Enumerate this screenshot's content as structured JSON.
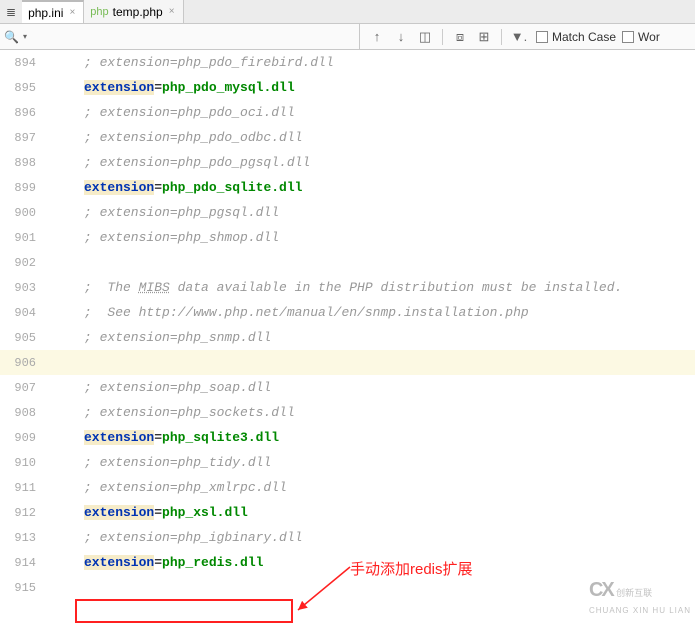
{
  "tabs": [
    {
      "label": "php.ini",
      "icon": "≣"
    },
    {
      "label": "temp.php",
      "icon": "php"
    }
  ],
  "toolbar": {
    "matchCase": "Match Case",
    "words": "Wor"
  },
  "lines": [
    {
      "num": "894",
      "type": "comment",
      "text": "; extension=php_pdo_firebird.dll"
    },
    {
      "num": "895",
      "type": "active",
      "key": "extension",
      "eq": "=",
      "val": "php_pdo_mysql.dll"
    },
    {
      "num": "896",
      "type": "comment",
      "text": "; extension=php_pdo_oci.dll"
    },
    {
      "num": "897",
      "type": "comment",
      "text": "; extension=php_pdo_odbc.dll"
    },
    {
      "num": "898",
      "type": "comment",
      "text": "; extension=php_pdo_pgsql.dll"
    },
    {
      "num": "899",
      "type": "active",
      "key": "extension",
      "eq": "=",
      "val": "php_pdo_sqlite.dll"
    },
    {
      "num": "900",
      "type": "comment",
      "text": "; extension=php_pgsql.dll"
    },
    {
      "num": "901",
      "type": "comment",
      "text": "; extension=php_shmop.dll"
    },
    {
      "num": "902",
      "type": "blank",
      "text": ""
    },
    {
      "num": "903",
      "type": "comment_mibs",
      "prefix": ";  The ",
      "mibs": "MIBS",
      "suffix": " data available in the PHP distribution must be installed."
    },
    {
      "num": "904",
      "type": "comment",
      "text": ";  See http://www.php.net/manual/en/snmp.installation.php"
    },
    {
      "num": "905",
      "type": "comment",
      "text": "; extension=php_snmp.dll"
    },
    {
      "num": "906",
      "type": "current_blank",
      "text": ""
    },
    {
      "num": "907",
      "type": "comment",
      "text": "; extension=php_soap.dll"
    },
    {
      "num": "908",
      "type": "comment",
      "text": "; extension=php_sockets.dll"
    },
    {
      "num": "909",
      "type": "active",
      "key": "extension",
      "eq": "=",
      "val": "php_sqlite3.dll"
    },
    {
      "num": "910",
      "type": "comment",
      "text": "; extension=php_tidy.dll"
    },
    {
      "num": "911",
      "type": "comment",
      "text": "; extension=php_xmlrpc.dll"
    },
    {
      "num": "912",
      "type": "active",
      "key": "extension",
      "eq": "=",
      "val": "php_xsl.dll"
    },
    {
      "num": "913",
      "type": "comment",
      "text": "; extension=php_igbinary.dll"
    },
    {
      "num": "914",
      "type": "active",
      "key": "extension",
      "eq": "=",
      "val": "php_redis.dll"
    },
    {
      "num": "915",
      "type": "blank",
      "text": ""
    }
  ],
  "annotation": "手动添加redis扩展",
  "watermark": {
    "logo": "CX",
    "en": "CHUANG XIN HU LIAN",
    "cn": "创新互联"
  }
}
